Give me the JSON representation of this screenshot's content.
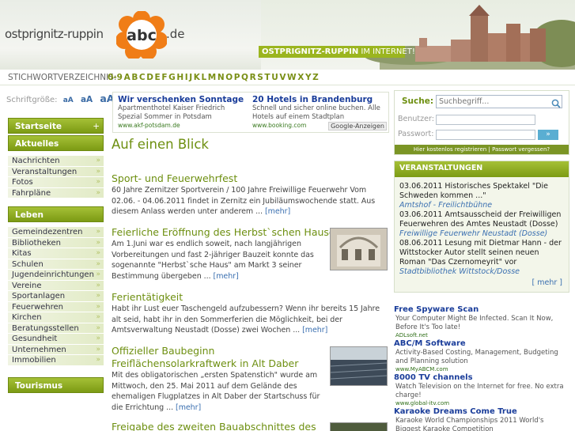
{
  "header": {
    "logo_text": "ostprignitz-ruppin",
    "logo_abc": "abc",
    "logo_tld": ".de",
    "banner_strong": "OSTPRIGNITZ-RUPPIN",
    "banner_rest": " IM INTERNET!"
  },
  "alphabet": {
    "label": "STICHWORTVERZEICHNIS:",
    "letters": [
      "0-9",
      "A",
      "B",
      "C",
      "D",
      "E",
      "F",
      "G",
      "H",
      "I",
      "J",
      "K",
      "L",
      "M",
      "N",
      "O",
      "P",
      "Q",
      "R",
      "S",
      "T",
      "U",
      "V",
      "W",
      "X",
      "Y",
      "Z"
    ]
  },
  "fontsize": {
    "label": "Schriftgröße:",
    "small": "aA",
    "medium": "aA",
    "large": "aA"
  },
  "sidebar": {
    "startseite": "Startseite",
    "startseite_icon": "+",
    "aktuelles": "Aktuelles",
    "aktuelles_items": [
      "Nachrichten",
      "Veranstaltungen",
      "Fotos",
      "Fahrpläne"
    ],
    "leben": "Leben",
    "leben_items": [
      "Gemeindezentren",
      "Bibliotheken",
      "Kitas",
      "Schulen",
      "Jugendeinrichtungen",
      "Vereine",
      "Sportanlagen",
      "Feuerwehren",
      "Kirchen",
      "Beratungsstellen",
      "Gesundheit",
      "Unternehmen",
      "Immobilien"
    ],
    "tourismus": "Tourismus",
    "chevron": "»"
  },
  "ads": [
    {
      "title": "Wir verschenken Sonntage",
      "text": "Apartmenthotel Kaiser Friedrich Spezial Sommer in Potsdam",
      "url": "www.akf-potsdam.de"
    },
    {
      "title": "20 Hotels in Brandenburg",
      "text": "Schnell und sicher online buchen. Alle Hotels auf einem Stadtplan",
      "url": "www.booking.com"
    }
  ],
  "ads_label": "Google-Anzeigen",
  "main": {
    "title": "Auf einen Blick",
    "more": "[mehr]",
    "articles": [
      {
        "title": "Sport- und Feuerwehrfest",
        "text": "60 Jahre Zernitzer Sportverein / 100 Jahre Freiwillige Feuerwehr   Vom 02.06. - 04.06.2011 findet in Zernitz ein Jubiläumswochende statt.   Aus diesem Anlass werden unter anderem ..."
      },
      {
        "title": "Feierliche Eröffnung des Herbst`schen Hauses",
        "text": "Am 1.Juni war es endlich soweit, nach langjährigen Vorbereitungen und fast 2-jähriger Bauzeit konnte das sogenannte \"Herbst`sche Haus\" am Markt 3 seiner Bestimmung  übergeben ..."
      },
      {
        "title": "Ferientätigkeit",
        "text": "Habt ihr Lust euer Taschengeld aufzubessern?   Wenn ihr bereits 15 Jahre alt seid,  habt ihr in den Sommerferien die Möglichkeit, bei der Amtsverwaltung Neustadt (Dosse) zwei Wochen ..."
      },
      {
        "title": "Offizieller Baubeginn Freiflächensolarkraftwerk in Alt Daber",
        "text": "Mit des obligatorischen „ersten Spatenstich\" wurde am Mittwoch, den 25. Mai 2011 auf dem Gelände des ehemaligen Flugplatzes in Alt Daber  der Startschuss für die Errichtung ..."
      },
      {
        "title": "Freigabe des zweiten Bauabschnittes des",
        "text": ""
      }
    ]
  },
  "search": {
    "label": "Suche:",
    "placeholder": "Suchbegriff...",
    "user_label": "Benutzer:",
    "pass_label": "Passwort:",
    "login_arrow": "»",
    "register": "Hier kostenlos registrieren",
    "forgot": "Passwort vergessen?",
    "separator": "|"
  },
  "events": {
    "head": "VERANSTALTUNGEN",
    "items": [
      {
        "text": "03.06.2011 Historisches Spektakel \"Die Schweden kommen ...\"",
        "loc": "Amtshof - Freilichtbühne"
      },
      {
        "text": "03.06.2011 Amtsausscheid der Freiwilligen Feuerwehren des Amtes Neustadt (Dosse)",
        "loc": "Freiwillige Feuerwehr Neustadt (Dosse)"
      },
      {
        "text": "08.06.2011 Lesung mit Dietmar Hann - der Wittstocker Autor stellt seinen neuen Roman \"Das Czernomeyrit\" vor",
        "loc": "Stadtbibliothek Wittstock/Dosse"
      }
    ],
    "more": "[ mehr ]"
  },
  "sponsors": [
    {
      "title": "Free Spyware Scan",
      "text": "Your Computer Might Be Infected. Scan It Now, Before It's Too late!",
      "url": "ADLsoft.net"
    },
    {
      "title": "ABC/M Software",
      "text": "Activity-Based Costing, Management, Budgeting and Planning solution",
      "url": "www.MyABCM.com"
    },
    {
      "title": "8000 TV channels",
      "text": "Watch Television on the Internet for free. No extra charge!",
      "url": "www.global-itv.com"
    },
    {
      "title": "Karaoke Dreams Come True",
      "text": "Karaoke World Championships 2011 World's Biggest Karaoke Competition",
      "url": ""
    }
  ]
}
